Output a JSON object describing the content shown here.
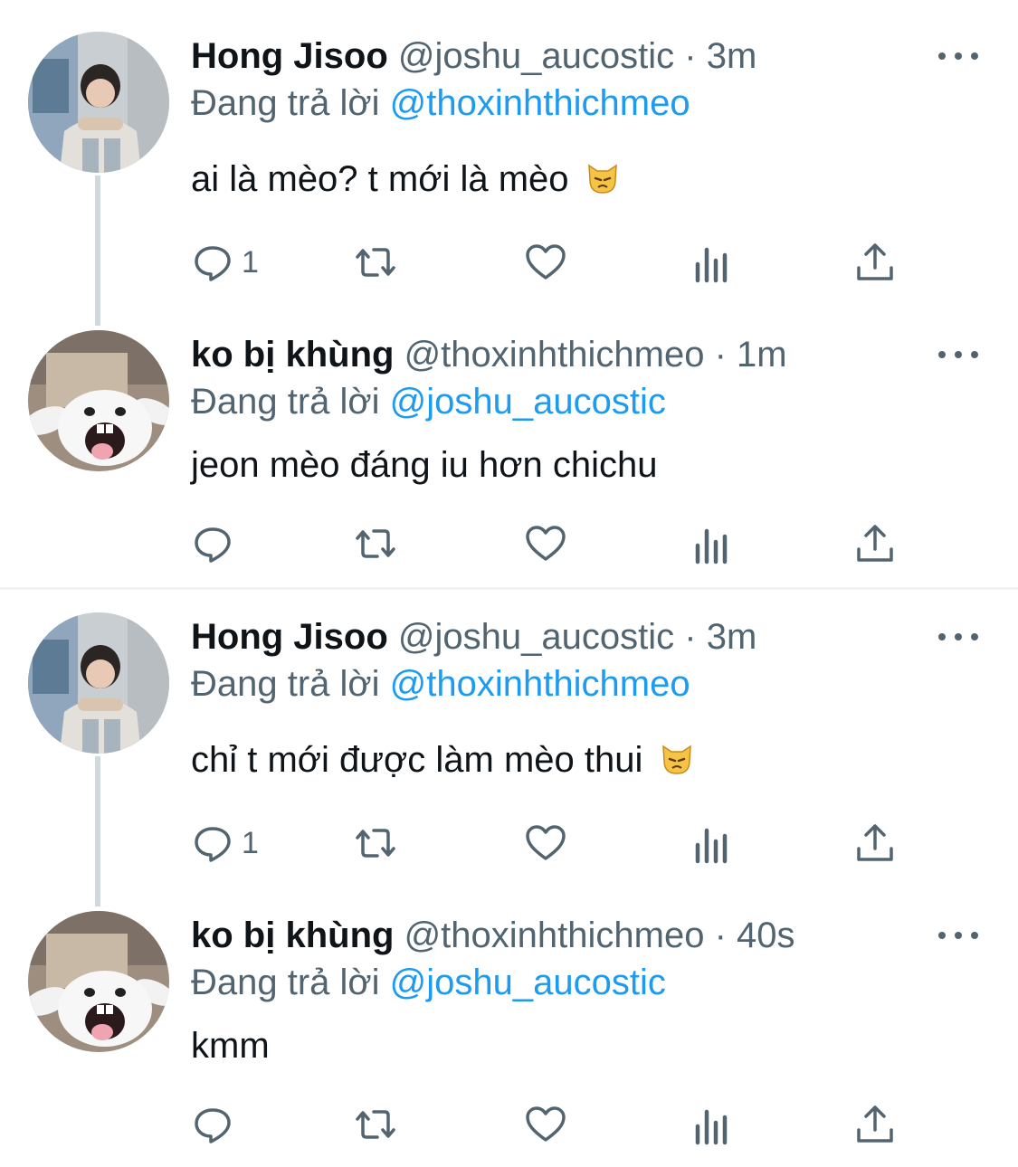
{
  "threads": [
    {
      "tweets": [
        {
          "display_name": "Hong Jisoo",
          "handle": "@joshu_aucostic",
          "dot": "·",
          "time": "3m",
          "reply_prefix": "Đang trả lời",
          "reply_to": "@thoxinhthichmeo",
          "text": "ai là mèo? t mới là mèo",
          "emoji": "pouting-cat-emoji",
          "reply_count": "1",
          "avatar": "person-avatar"
        },
        {
          "display_name": "ko bị khùng",
          "handle": "@thoxinhthichmeo",
          "dot": "·",
          "time": "1m",
          "reply_prefix": "Đang trả lời",
          "reply_to": "@joshu_aucostic",
          "text": "jeon mèo đáng iu hơn chichu",
          "reply_count": "",
          "avatar": "white-bunny-avatar"
        }
      ]
    },
    {
      "tweets": [
        {
          "display_name": "Hong Jisoo",
          "handle": "@joshu_aucostic",
          "dot": "·",
          "time": "3m",
          "reply_prefix": "Đang trả lời",
          "reply_to": "@thoxinhthichmeo",
          "text": "chỉ t mới được làm mèo thui",
          "emoji": "pouting-cat-emoji",
          "reply_count": "1",
          "avatar": "person-avatar"
        },
        {
          "display_name": "ko bị khùng",
          "handle": "@thoxinhthichmeo",
          "dot": "·",
          "time": "40s",
          "reply_prefix": "Đang trả lời",
          "reply_to": "@joshu_aucostic",
          "text": "kmm",
          "reply_count": "",
          "avatar": "white-bunny-avatar"
        }
      ]
    }
  ],
  "icons": {
    "reply": "reply-icon",
    "retweet": "retweet-icon",
    "like": "heart-icon",
    "views": "views-icon",
    "share": "share-icon",
    "more": "more-icon"
  },
  "colors": {
    "link": "#1d9bf0",
    "secondary_text": "#536471",
    "primary_text": "#0f1419",
    "thread_line": "#cfd9de",
    "divider": "#eff3f4"
  }
}
